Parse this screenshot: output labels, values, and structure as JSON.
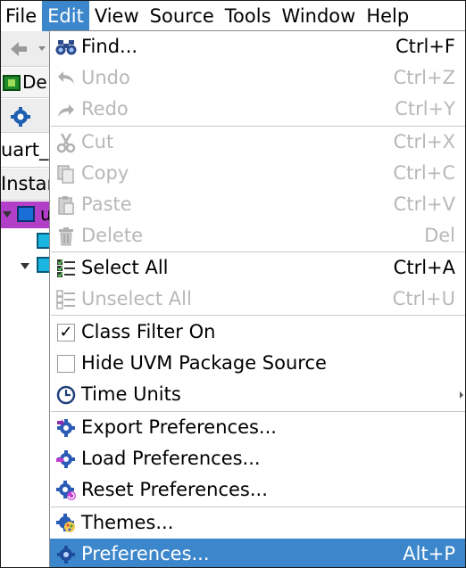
{
  "menubar": {
    "items": [
      {
        "label": "File",
        "active": false
      },
      {
        "label": "Edit",
        "active": true
      },
      {
        "label": "View",
        "active": false
      },
      {
        "label": "Source",
        "active": false
      },
      {
        "label": "Tools",
        "active": false
      },
      {
        "label": "Window",
        "active": false
      },
      {
        "label": "Help",
        "active": false
      }
    ]
  },
  "background": {
    "tab_text": "De",
    "combo_text": "uart_",
    "header_text": "Instar",
    "tree_letter": "u"
  },
  "edit_menu": {
    "find": {
      "label": "Find...",
      "shortcut": "Ctrl+F",
      "icon": "binoculars-icon"
    },
    "undo": {
      "label": "Undo",
      "shortcut": "Ctrl+Z",
      "icon": "undo-arrow-icon"
    },
    "redo": {
      "label": "Redo",
      "shortcut": "Ctrl+Y",
      "icon": "redo-arrow-icon"
    },
    "cut": {
      "label": "Cut",
      "shortcut": "Ctrl+X",
      "icon": "scissors-icon"
    },
    "copy": {
      "label": "Copy",
      "shortcut": "Ctrl+C",
      "icon": "copy-icon"
    },
    "paste": {
      "label": "Paste",
      "shortcut": "Ctrl+V",
      "icon": "clipboard-icon"
    },
    "delete": {
      "label": "Delete",
      "shortcut": "Del",
      "icon": "trash-icon"
    },
    "select_all": {
      "label": "Select All",
      "shortcut": "Ctrl+A",
      "icon": "select-all-icon"
    },
    "unselect_all": {
      "label": "Unselect All",
      "shortcut": "Ctrl+U",
      "icon": "unselect-all-icon"
    },
    "class_filter": {
      "label": "Class Filter On",
      "checked": true,
      "check_mark": "✓"
    },
    "hide_uvm": {
      "label": "Hide UVM Package Source",
      "checked": false
    },
    "time_units": {
      "label": "Time Units",
      "icon": "clock-icon",
      "has_submenu": true
    },
    "export_prefs": {
      "label": "Export Preferences...",
      "icon": "gear-export-icon"
    },
    "load_prefs": {
      "label": "Load Preferences...",
      "icon": "gear-load-icon"
    },
    "reset_prefs": {
      "label": "Reset Preferences...",
      "icon": "gear-reset-icon"
    },
    "themes": {
      "label": "Themes...",
      "icon": "palette-icon"
    },
    "preferences": {
      "label": "Preferences...",
      "shortcut": "Alt+P",
      "icon": "gear-icon",
      "highlighted": true
    }
  },
  "colors": {
    "highlight": "#3c87cb",
    "disabled_text": "#b8b8b8",
    "selected_tree_row": "#b23fc7"
  }
}
